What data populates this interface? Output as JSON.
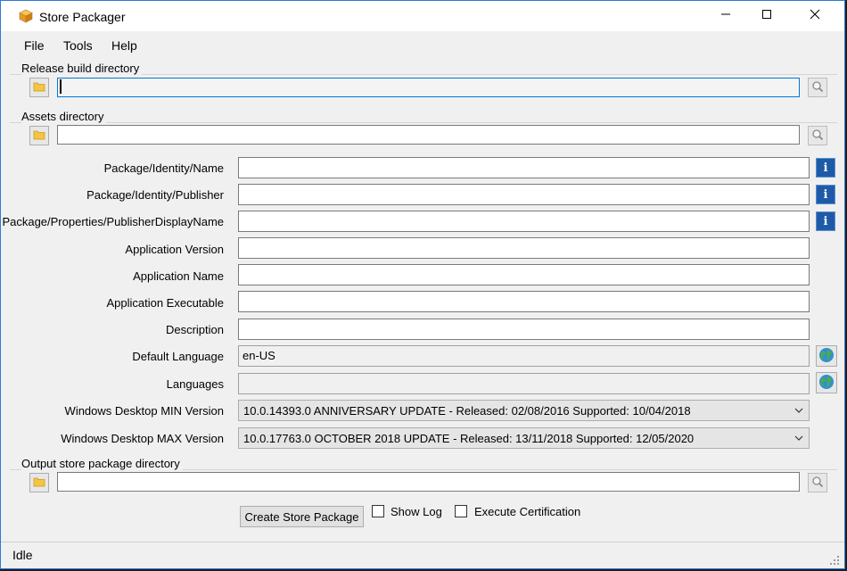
{
  "window": {
    "title": "Store Packager",
    "minimize_icon": "minimize-icon",
    "maximize_icon": "maximize-icon",
    "close_icon": "close-icon"
  },
  "menu": [
    "File",
    "Tools",
    "Help"
  ],
  "release_build": {
    "label": "Release build directory",
    "value": ""
  },
  "assets": {
    "label": "Assets directory",
    "value": ""
  },
  "fields": {
    "identity_name": {
      "label": "Package/Identity/Name",
      "value": ""
    },
    "identity_publisher": {
      "label": "Package/Identity/Publisher",
      "value": ""
    },
    "publisher_display_name": {
      "label": "Package/Properties/PublisherDisplayName",
      "value": ""
    },
    "app_version": {
      "label": "Application Version",
      "value": ""
    },
    "app_name": {
      "label": "Application Name",
      "value": ""
    },
    "app_executable": {
      "label": "Application Executable",
      "value": ""
    },
    "description": {
      "label": "Description",
      "value": ""
    },
    "default_language": {
      "label": "Default Language",
      "value": "en-US"
    },
    "languages": {
      "label": "Languages",
      "value": ""
    }
  },
  "min_version": {
    "label": "Windows Desktop MIN Version",
    "selected": "10.0.14393.0 ANNIVERSARY UPDATE - Released: 02/08/2016 Supported: 10/04/2018"
  },
  "max_version": {
    "label": "Windows Desktop MAX Version",
    "selected": "10.0.17763.0 OCTOBER 2018 UPDATE - Released: 13/11/2018 Supported: 12/05/2020"
  },
  "output": {
    "label": "Output store package directory",
    "value": ""
  },
  "actions": {
    "create_label": "Create Store Package",
    "show_log_label": "Show Log",
    "execute_cert_label": "Execute Certification"
  },
  "status": "Idle",
  "colors": {
    "accent": "#0078d7",
    "info_button": "#1e5aa8",
    "folder": "#f5c542"
  }
}
